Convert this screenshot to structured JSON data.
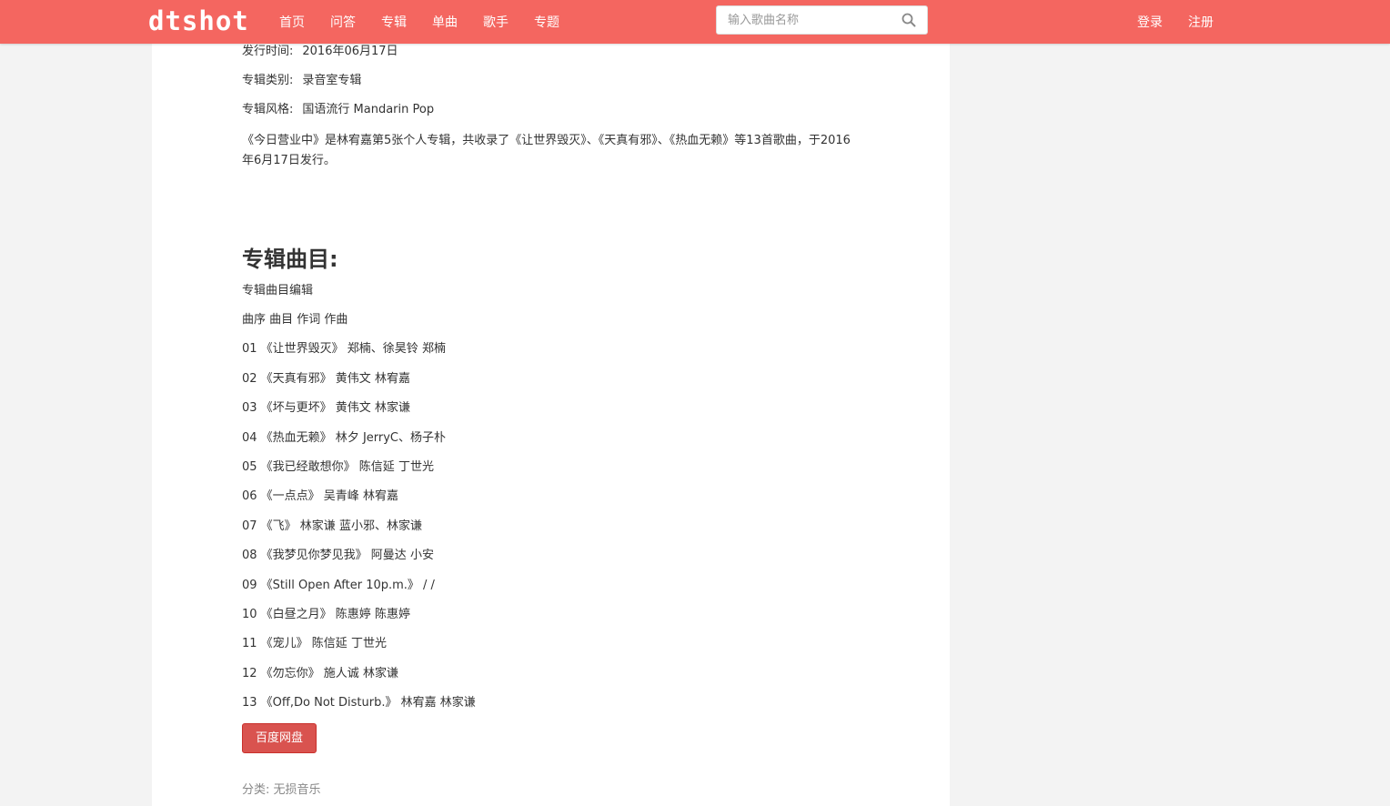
{
  "nav": {
    "logo": "dtshot",
    "links": [
      "首页",
      "问答",
      "专辑",
      "单曲",
      "歌手",
      "专题"
    ],
    "search_placeholder": "输入歌曲名称",
    "login": "登录",
    "register": "注册"
  },
  "album": {
    "release_label": "发行时间:",
    "release_value": "2016年06月17日",
    "type_label": "专辑类别:",
    "type_value": "录音室专辑",
    "genre_label": "专辑风格:",
    "genre_value": "国语流行 Mandarin Pop",
    "description": "《今日营业中》是林宥嘉第5张个人专辑，共收录了《让世界毁灭》、《天真有邪》、《热血无赖》等13首歌曲，于2016年6月17日发行。"
  },
  "tracklist": {
    "title": "专辑曲目:",
    "subtitle": "专辑曲目编辑",
    "header": "曲序 曲目 作词 作曲",
    "tracks": [
      "01 《让世界毁灭》 郑楠、徐昊铃 郑楠",
      "02 《天真有邪》 黄伟文 林宥嘉",
      "03 《坏与更坏》 黄伟文 林家谦",
      "04 《热血无赖》 林夕 JerryC、杨子朴",
      "05 《我已经敢想你》 陈信延 丁世光",
      "06 《一点点》 吴青峰 林宥嘉",
      "07 《飞》 林家谦 蓝小邪、林家谦",
      "08 《我梦见你梦见我》 阿曼达 小安",
      "09 《Still Open After 10p.m.》 / /",
      "10 《白昼之月》 陈惠婷 陈惠婷",
      "11 《宠儿》 陈信延 丁世光",
      "12 《勿忘你》 施人诚 林家谦",
      "13 《Off,Do Not Disturb.》 林宥嘉 林家谦"
    ]
  },
  "download_button": "百度网盘",
  "category": {
    "label": "分类:",
    "value": "无损音乐"
  },
  "colors": {
    "navbar": "#f46660",
    "button": "#d9534f"
  }
}
